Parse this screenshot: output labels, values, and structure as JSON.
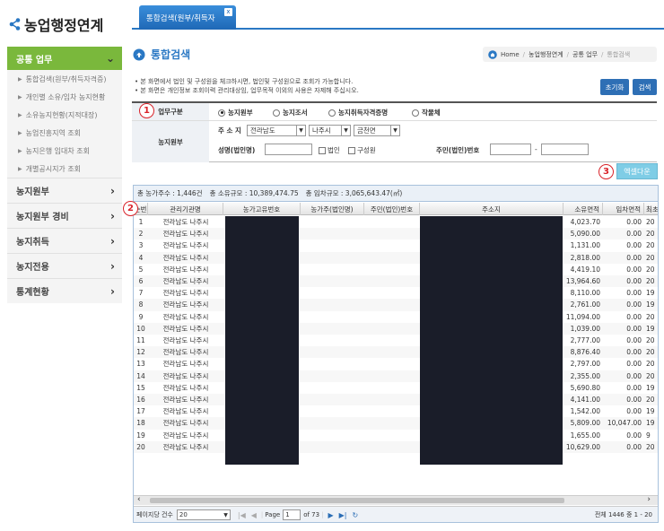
{
  "sidebar": {
    "logo": "농업행정연계",
    "active_menu": "공통 업무",
    "sub_items": [
      "통합검색(원부/취득자격증)",
      "개인별 소유/임차 농지현황",
      "소유농지현황(지적대장)",
      "농업진흥지역 조회",
      "농지은행 임대차 조회",
      "개별공시지가 조회"
    ],
    "menus": [
      "농지원부",
      "농지원부 경비",
      "농지취득",
      "농지전용",
      "통계현황"
    ]
  },
  "tab": {
    "label": "통합검색(원부/취득자",
    "close": "x"
  },
  "page": {
    "title": "통합검색",
    "notice1": "• 본 화면에서 법인 및 구성원을 체크하시면, 법인및 구성원으로 조회가 가능합니다.",
    "notice2": "• 본 화면은 개인정보 조회이력 관리대상임, 업무목적 이외의 사용은 자제해 주십시오."
  },
  "breadcrumb": [
    "Home",
    "농업행정연계",
    "공통 업무",
    "통합검색"
  ],
  "buttons": {
    "reset": "초기화",
    "search": "검색",
    "excel": "엑셀다운"
  },
  "markers": [
    "1",
    "2",
    "3"
  ],
  "form": {
    "type_label": "업무구분",
    "radios": [
      "농지원부",
      "농지조서",
      "농지취득자격증명",
      "작물체"
    ],
    "selected_radio": 0,
    "section_label": "농지원부",
    "address_label": "주 소 지",
    "sido": "전라남도",
    "sigungu": "나주시",
    "eupmyeon": "금천면",
    "name_label": "성명(법인명)",
    "chk_corp": "법인",
    "chk_member": "구성원",
    "reg_label": "주민(법인)번호",
    "reg_dash": "-"
  },
  "summary": {
    "farmers": "총 농가주수 : 1,446건",
    "own": "총 소유규모 : 10,389,474.75",
    "lease": "총 임차규모 : 3,065,643.47(㎡)"
  },
  "table": {
    "headers": [
      "순번",
      "관리기관명",
      "농가고유번호",
      "농가주(법인명)",
      "주민(법인)번호",
      "주소지",
      "소유면적",
      "임차면적",
      "최초"
    ],
    "rows": [
      [
        "1",
        "전라남도 나주시",
        "4,023.70",
        "0.00",
        "20"
      ],
      [
        "2",
        "전라남도 나주시",
        "5,090.00",
        "0.00",
        "20"
      ],
      [
        "3",
        "전라남도 나주시",
        "1,131.00",
        "0.00",
        "20"
      ],
      [
        "4",
        "전라남도 나주시",
        "2,818.00",
        "0.00",
        "20"
      ],
      [
        "5",
        "전라남도 나주시",
        "4,419.10",
        "0.00",
        "20"
      ],
      [
        "6",
        "전라남도 나주시",
        "13,964.60",
        "0.00",
        "20"
      ],
      [
        "7",
        "전라남도 나주시",
        "8,110.00",
        "0.00",
        "19"
      ],
      [
        "8",
        "전라남도 나주시",
        "2,761.00",
        "0.00",
        "19"
      ],
      [
        "9",
        "전라남도 나주시",
        "11,094.00",
        "0.00",
        "20"
      ],
      [
        "10",
        "전라남도 나주시",
        "1,039.00",
        "0.00",
        "19"
      ],
      [
        "11",
        "전라남도 나주시",
        "2,777.00",
        "0.00",
        "20"
      ],
      [
        "12",
        "전라남도 나주시",
        "8,876.40",
        "0.00",
        "20"
      ],
      [
        "13",
        "전라남도 나주시",
        "2,797.00",
        "0.00",
        "20"
      ],
      [
        "14",
        "전라남도 나주시",
        "2,355.00",
        "0.00",
        "20"
      ],
      [
        "15",
        "전라남도 나주시",
        "5,690.80",
        "0.00",
        "19"
      ],
      [
        "16",
        "전라남도 나주시",
        "4,141.00",
        "0.00",
        "20"
      ],
      [
        "17",
        "전라남도 나주시",
        "1,542.00",
        "0.00",
        "19"
      ],
      [
        "18",
        "전라남도 나주시",
        "5,809.00",
        "10,047.00",
        "19"
      ],
      [
        "19",
        "전라남도 나주시",
        "1,655.00",
        "0.00",
        "9"
      ],
      [
        "20",
        "전라남도 나주시",
        "10,629.00",
        "0.00",
        "20"
      ]
    ]
  },
  "pager": {
    "per_page_label": "페이지당 건수",
    "per_page": "20",
    "page_label": "Page",
    "page": "1",
    "of": "of 73",
    "total": "전체 1446 중 1 - 20"
  },
  "colors": {
    "accent": "#2a78c4",
    "menu_active": "#7ab83c",
    "marker": "#d9232a"
  }
}
